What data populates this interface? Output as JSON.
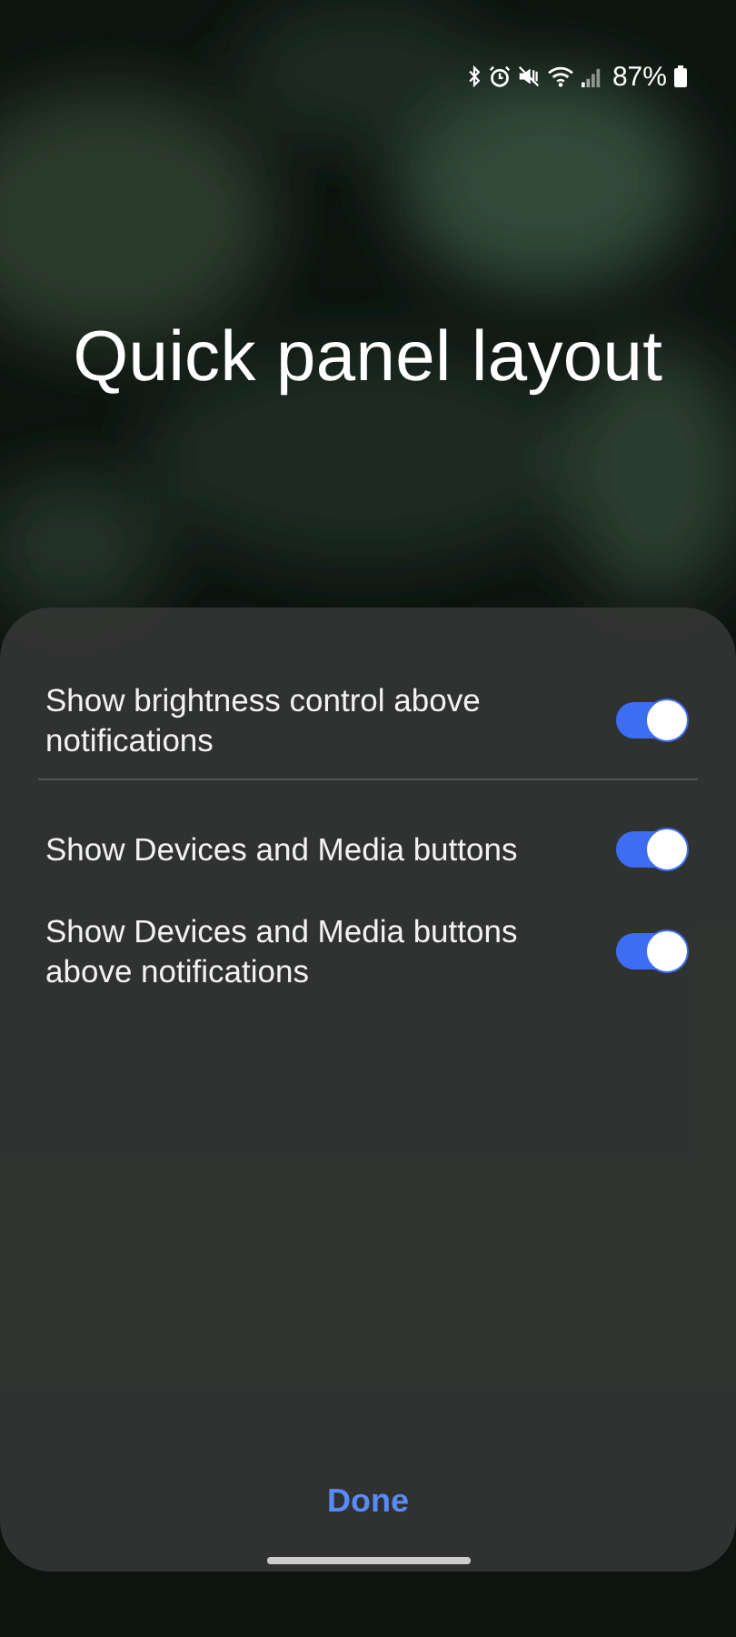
{
  "status_bar": {
    "battery": "87%"
  },
  "title": "Quick panel layout",
  "options": [
    {
      "label": "Show brightness control above notifications",
      "on": true
    },
    {
      "label": "Show Devices and Media buttons",
      "on": true
    },
    {
      "label": "Show Devices and Media buttons above notifications",
      "on": true
    }
  ],
  "done_button": "Done"
}
